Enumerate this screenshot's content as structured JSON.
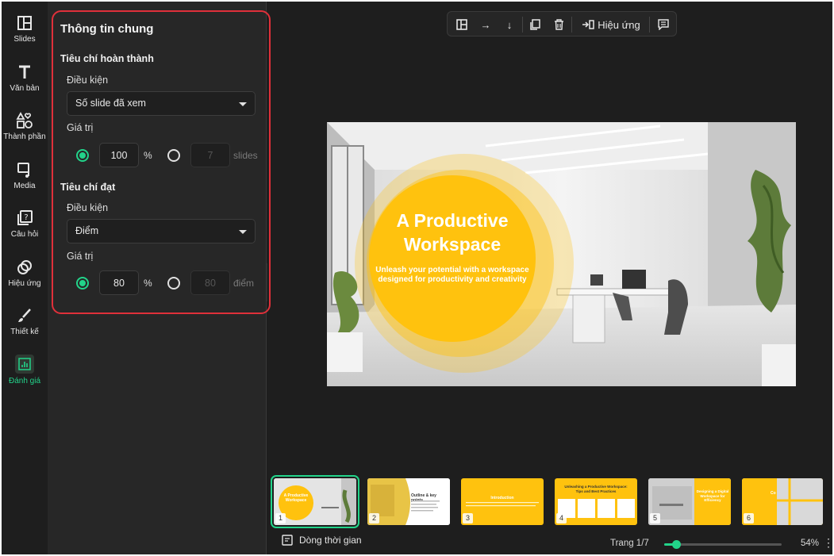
{
  "nav": {
    "items": [
      {
        "label": "Slides",
        "icon": "layout-icon"
      },
      {
        "label": "Văn bản",
        "icon": "text-icon"
      },
      {
        "label": "Thành phần",
        "icon": "shapes-icon"
      },
      {
        "label": "Media",
        "icon": "media-icon"
      },
      {
        "label": "Câu hỏi",
        "icon": "question-icon"
      },
      {
        "label": "Hiệu ứng",
        "icon": "effect-icon"
      },
      {
        "label": "Thiết kế",
        "icon": "brush-icon"
      },
      {
        "label": "Đánh giá",
        "icon": "chart-icon",
        "active": true
      }
    ]
  },
  "panel": {
    "title": "Thông tin chung",
    "completion": {
      "title": "Tiêu chí hoàn thành",
      "condition_label": "Điều kiện",
      "condition_value": "Số slide đã xem",
      "value_label": "Giá trị",
      "percent_value": "100",
      "percent_unit": "%",
      "slides_value": "7",
      "slides_unit": "slides"
    },
    "pass": {
      "title": "Tiêu chí đạt",
      "condition_label": "Điều kiện",
      "condition_value": "Điểm",
      "value_label": "Giá trị",
      "percent_value": "80",
      "percent_unit": "%",
      "points_value": "80",
      "points_unit": "điểm"
    }
  },
  "toolbar": {
    "effects_label": "Hiệu ứng"
  },
  "slide": {
    "title_line1": "A Productive",
    "title_line2": "Workspace",
    "subtitle_line1": "Unleash your potential with a workspace",
    "subtitle_line2": "designed for productivity and creativity"
  },
  "thumbnails": [
    {
      "number": "1",
      "text": "A Productive Workspace"
    },
    {
      "number": "2",
      "text": "Outline & key points"
    },
    {
      "number": "3",
      "text": "Introduction"
    },
    {
      "number": "4",
      "text": "Unleashing a Productive Workspace: Tips and Best Practices"
    },
    {
      "number": "5",
      "text": "Designing a Digital Workspace for Efficiency"
    },
    {
      "number": "6",
      "text": "Co"
    }
  ],
  "bottom": {
    "timeline_label": "Dòng thời gian",
    "page_info": "Trang 1/7",
    "zoom": "54%",
    "zoom_level": 0.1
  },
  "colors": {
    "accent": "#22d48a",
    "slide_yellow": "#ffc20e",
    "highlight": "#e0303a"
  }
}
